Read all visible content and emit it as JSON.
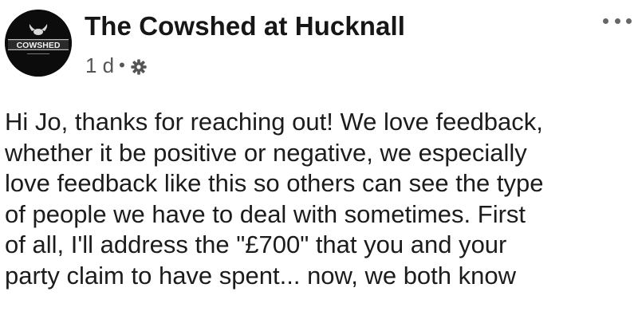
{
  "post": {
    "author": "The Cowshed at Hucknall",
    "avatar_text": "COWSHED",
    "timestamp": "1 d",
    "separator": "•",
    "privacy_icon": "gear-icon",
    "more_icon": "more-options-icon",
    "message": "Hi Jo, thanks for reaching out! We love feedback,\nwhether it be positive or negative, we especially\nlove feedback like this so others can see the type\nof people we have to deal with sometimes. First\nof all, I'll address the \"£700\" that you and your\nparty claim to have spent... now, we both know"
  }
}
